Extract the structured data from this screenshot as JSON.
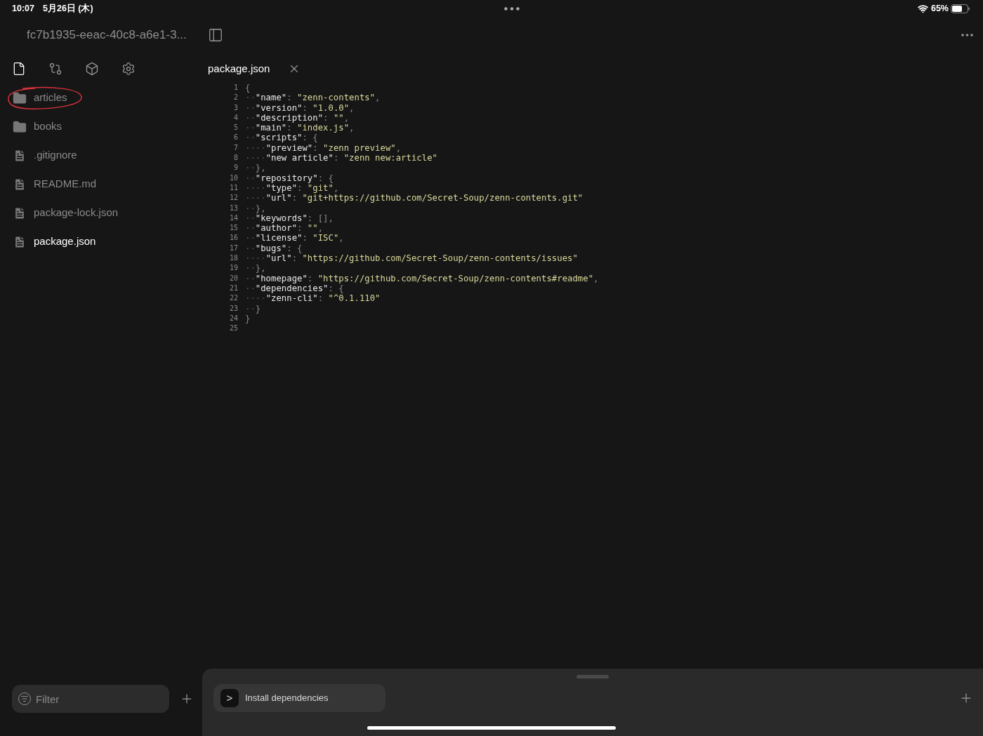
{
  "status_bar": {
    "time": "10:07",
    "date": "5月26日 (木)",
    "battery": "65%"
  },
  "header": {
    "title": "fc7b1935-eeac-40c8-a6e1-3..."
  },
  "sidebar": {
    "tabs": [
      {
        "kind": "files",
        "selected": true
      },
      {
        "kind": "git",
        "selected": false
      },
      {
        "kind": "packages",
        "selected": false
      },
      {
        "kind": "settings",
        "selected": false
      }
    ],
    "items": [
      {
        "kind": "folder",
        "label": "articles",
        "selected": false
      },
      {
        "kind": "folder",
        "label": "books",
        "selected": false
      },
      {
        "kind": "file",
        "label": ".gitignore",
        "selected": false
      },
      {
        "kind": "file",
        "label": "README.md",
        "selected": false
      },
      {
        "kind": "file",
        "label": "package-lock.json",
        "selected": false
      },
      {
        "kind": "file",
        "label": "package.json",
        "selected": true
      }
    ],
    "filter": {
      "placeholder": "Filter"
    }
  },
  "editor": {
    "tab": {
      "label": "package.json"
    },
    "lines": [
      {
        "number": "1",
        "tokens": [
          {
            "kind": "punct",
            "text": "{"
          }
        ]
      },
      {
        "number": "2",
        "tokens": [
          {
            "kind": "indent",
            "text": "··"
          },
          {
            "kind": "key",
            "text": "\"name\""
          },
          {
            "kind": "punct",
            "text": ": "
          },
          {
            "kind": "string",
            "text": "\"zenn-contents\""
          },
          {
            "kind": "punct",
            "text": ","
          }
        ]
      },
      {
        "number": "3",
        "tokens": [
          {
            "kind": "indent",
            "text": "··"
          },
          {
            "kind": "key",
            "text": "\"version\""
          },
          {
            "kind": "punct",
            "text": ": "
          },
          {
            "kind": "string",
            "text": "\"1.0.0\""
          },
          {
            "kind": "punct",
            "text": ","
          }
        ]
      },
      {
        "number": "4",
        "tokens": [
          {
            "kind": "indent",
            "text": "··"
          },
          {
            "kind": "key",
            "text": "\"description\""
          },
          {
            "kind": "punct",
            "text": ": "
          },
          {
            "kind": "string",
            "text": "\"\""
          },
          {
            "kind": "punct",
            "text": ","
          }
        ]
      },
      {
        "number": "5",
        "tokens": [
          {
            "kind": "indent",
            "text": "··"
          },
          {
            "kind": "key",
            "text": "\"main\""
          },
          {
            "kind": "punct",
            "text": ": "
          },
          {
            "kind": "string",
            "text": "\"index.js\""
          },
          {
            "kind": "punct",
            "text": ","
          }
        ]
      },
      {
        "number": "6",
        "tokens": [
          {
            "kind": "indent",
            "text": "··"
          },
          {
            "kind": "key",
            "text": "\"scripts\""
          },
          {
            "kind": "punct",
            "text": ": {"
          }
        ]
      },
      {
        "number": "7",
        "tokens": [
          {
            "kind": "indent",
            "text": "····"
          },
          {
            "kind": "key",
            "text": "\"preview\""
          },
          {
            "kind": "punct",
            "text": ": "
          },
          {
            "kind": "string",
            "text": "\"zenn preview\""
          },
          {
            "kind": "punct",
            "text": ","
          }
        ]
      },
      {
        "number": "8",
        "tokens": [
          {
            "kind": "indent",
            "text": "····"
          },
          {
            "kind": "key",
            "text": "\"new article\""
          },
          {
            "kind": "punct",
            "text": ": "
          },
          {
            "kind": "string",
            "text": "\"zenn new:article\""
          }
        ]
      },
      {
        "number": "9",
        "tokens": [
          {
            "kind": "indent",
            "text": "··"
          },
          {
            "kind": "punct",
            "text": "},"
          }
        ]
      },
      {
        "number": "10",
        "tokens": [
          {
            "kind": "indent",
            "text": "··"
          },
          {
            "kind": "key",
            "text": "\"repository\""
          },
          {
            "kind": "punct",
            "text": ": {"
          }
        ]
      },
      {
        "number": "11",
        "tokens": [
          {
            "kind": "indent",
            "text": "····"
          },
          {
            "kind": "key",
            "text": "\"type\""
          },
          {
            "kind": "punct",
            "text": ": "
          },
          {
            "kind": "string",
            "text": "\"git\""
          },
          {
            "kind": "punct",
            "text": ","
          }
        ]
      },
      {
        "number": "12",
        "tokens": [
          {
            "kind": "indent",
            "text": "····"
          },
          {
            "kind": "key",
            "text": "\"url\""
          },
          {
            "kind": "punct",
            "text": ": "
          },
          {
            "kind": "string",
            "text": "\"git+https://github.com/Secret-Soup/zenn-contents.git\""
          }
        ]
      },
      {
        "number": "13",
        "tokens": [
          {
            "kind": "indent",
            "text": "··"
          },
          {
            "kind": "punct",
            "text": "},"
          }
        ]
      },
      {
        "number": "14",
        "tokens": [
          {
            "kind": "indent",
            "text": "··"
          },
          {
            "kind": "key",
            "text": "\"keywords\""
          },
          {
            "kind": "punct",
            "text": ": [],"
          }
        ]
      },
      {
        "number": "15",
        "tokens": [
          {
            "kind": "indent",
            "text": "··"
          },
          {
            "kind": "key",
            "text": "\"author\""
          },
          {
            "kind": "punct",
            "text": ": "
          },
          {
            "kind": "string",
            "text": "\"\""
          },
          {
            "kind": "punct",
            "text": ","
          }
        ]
      },
      {
        "number": "16",
        "tokens": [
          {
            "kind": "indent",
            "text": "··"
          },
          {
            "kind": "key",
            "text": "\"license\""
          },
          {
            "kind": "punct",
            "text": ": "
          },
          {
            "kind": "string",
            "text": "\"ISC\""
          },
          {
            "kind": "punct",
            "text": ","
          }
        ]
      },
      {
        "number": "17",
        "tokens": [
          {
            "kind": "indent",
            "text": "··"
          },
          {
            "kind": "key",
            "text": "\"bugs\""
          },
          {
            "kind": "punct",
            "text": ": {"
          }
        ]
      },
      {
        "number": "18",
        "tokens": [
          {
            "kind": "indent",
            "text": "····"
          },
          {
            "kind": "key",
            "text": "\"url\""
          },
          {
            "kind": "punct",
            "text": ": "
          },
          {
            "kind": "string",
            "text": "\"https://github.com/Secret-Soup/zenn-contents/issues\""
          }
        ]
      },
      {
        "number": "19",
        "tokens": [
          {
            "kind": "indent",
            "text": "··"
          },
          {
            "kind": "punct",
            "text": "},"
          }
        ]
      },
      {
        "number": "20",
        "tokens": [
          {
            "kind": "indent",
            "text": "··"
          },
          {
            "kind": "key",
            "text": "\"homepage\""
          },
          {
            "kind": "punct",
            "text": ": "
          },
          {
            "kind": "string",
            "text": "\"https://github.com/Secret-Soup/zenn-contents#readme\""
          },
          {
            "kind": "punct",
            "text": ","
          }
        ]
      },
      {
        "number": "21",
        "tokens": [
          {
            "kind": "indent",
            "text": "··"
          },
          {
            "kind": "key",
            "text": "\"dependencies\""
          },
          {
            "kind": "punct",
            "text": ": {"
          }
        ]
      },
      {
        "number": "22",
        "tokens": [
          {
            "kind": "indent",
            "text": "····"
          },
          {
            "kind": "key",
            "text": "\"zenn-cli\""
          },
          {
            "kind": "punct",
            "text": ": "
          },
          {
            "kind": "string",
            "text": "\"^0.1.110\""
          }
        ]
      },
      {
        "number": "23",
        "tokens": [
          {
            "kind": "indent",
            "text": "··"
          },
          {
            "kind": "punct",
            "text": "}"
          }
        ]
      },
      {
        "number": "24",
        "tokens": [
          {
            "kind": "punct",
            "text": "}"
          }
        ]
      },
      {
        "number": "25"
      }
    ]
  },
  "terminal": {
    "prompt": ">",
    "task": "Install dependencies"
  }
}
